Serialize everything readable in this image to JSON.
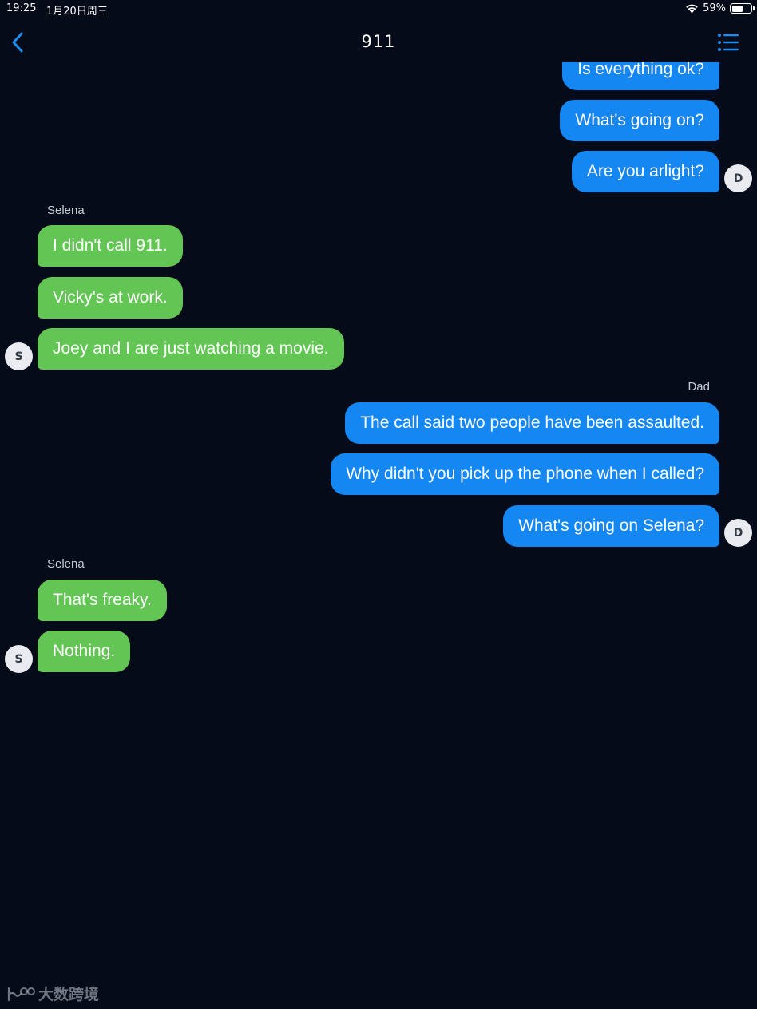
{
  "status_bar": {
    "time": "19:25",
    "date": "1月20日周三",
    "battery_percent": "59%",
    "battery_level": 0.59
  },
  "nav": {
    "title": "911",
    "back_icon": "chevron-left-icon",
    "menu_icon": "list-icon",
    "accent_color": "#1f8cf0"
  },
  "colors": {
    "background": "#050b18",
    "sent_bubble": "#1587f3",
    "received_bubble": "#62c554"
  },
  "messages": [
    {
      "from": "dad",
      "text": "Is everything ok?"
    },
    {
      "from": "dad",
      "text": "What's going on?"
    },
    {
      "from": "dad",
      "text": "Are you arlight?",
      "avatar": "D"
    },
    {
      "from": "selena",
      "sender": "Selena",
      "text": "I didn't call 911."
    },
    {
      "from": "selena",
      "text": "Vicky's at work."
    },
    {
      "from": "selena",
      "text": "Joey and I are just watching a movie.",
      "avatar": "S"
    },
    {
      "from": "dad",
      "sender": "Dad",
      "text": "The call said two people have been assaulted."
    },
    {
      "from": "dad",
      "text": "Why didn't you pick up the phone when I called?"
    },
    {
      "from": "dad",
      "text": "What's going on Selena?",
      "avatar": "D"
    },
    {
      "from": "selena",
      "sender": "Selena",
      "text": "That's freaky."
    },
    {
      "from": "selena",
      "text": "Nothing.",
      "avatar": "S"
    }
  ],
  "watermark": "大数跨境"
}
